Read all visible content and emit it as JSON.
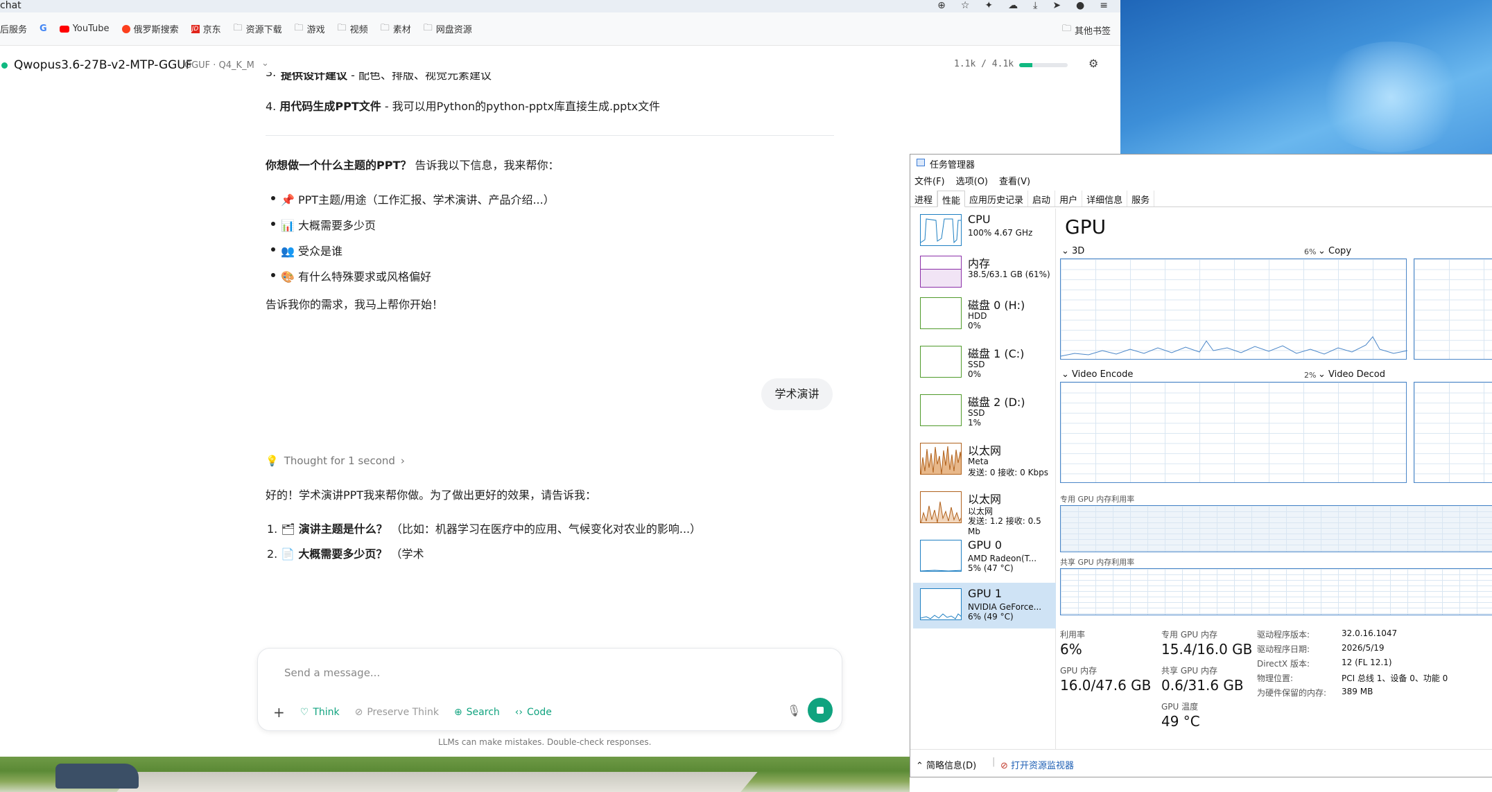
{
  "browser": {
    "tab_title": "chat",
    "bookmarks": [
      "后服务",
      "G",
      "YouTube",
      "俄罗斯搜索",
      "京东",
      "资源下载",
      "游戏",
      "视频",
      "素材",
      "网盘资源"
    ],
    "other_bookmarks": "其他书签"
  },
  "chat": {
    "model": "Qwopus3.6-27B-v2-MTP-GGUF",
    "format": "GGUF · Q4_K_M",
    "context": "1.1k / 4.1k",
    "context_fraction": 0.27,
    "cut_line": {
      "bold": "提供设计建议",
      "rest": " - 配色、排版、视觉元素建议"
    },
    "item4": {
      "num": "4.",
      "bold": "用代码生成PPT文件",
      "rest": " - 我可以用Python的python-pptx库直接生成.pptx文件"
    },
    "question": {
      "bold": "你想做一个什么主题的PPT？",
      "rest": " 告诉我以下信息，我来帮你："
    },
    "bullets": [
      "📌 PPT主题/用途（工作汇报、学术演讲、产品介绍...）",
      "📊 大概需要多少页",
      "👥 受众是谁",
      "🎨 有什么特殊要求或风格偏好"
    ],
    "closing": "告诉我你的需求，我马上帮你开始！",
    "user_message": "学术演讲",
    "thought": "Thought for 1 second",
    "reply_intro": "好的！学术演讲PPT我来帮你做。为了做出更好的效果，请告诉我：",
    "reply_items": [
      {
        "num": "1.",
        "emoji": "🗂",
        "bold": "演讲主题是什么？",
        "rest": " （比如：机器学习在医疗中的应用、气候变化对农业的影响...）"
      },
      {
        "num": "2.",
        "emoji": "📄",
        "bold": "大概需要多少页？",
        "rest": " （学术"
      }
    ],
    "input_placeholder": "Send a message...",
    "tools": {
      "think": "Think",
      "preserve_think": "Preserve Think",
      "search": "Search",
      "code": "Code"
    },
    "disclaimer": "LLMs can make mistakes. Double-check responses."
  },
  "taskmgr": {
    "title": "任务管理器",
    "menu": [
      "文件(F)",
      "选项(O)",
      "查看(V)"
    ],
    "tabs": [
      "进程",
      "性能",
      "应用历史记录",
      "启动",
      "用户",
      "详细信息",
      "服务"
    ],
    "active_tab": "性能",
    "resources": [
      {
        "name": "CPU",
        "l1": "100% 4.67 GHz",
        "l2": "",
        "color": "#1e7fc2"
      },
      {
        "name": "内存",
        "l1": "38.5/63.1 GB (61%)",
        "l2": "",
        "color": "#8b2fa8"
      },
      {
        "name": "磁盘 0 (H:)",
        "l1": "HDD",
        "l2": "0%",
        "color": "#4f9a2a"
      },
      {
        "name": "磁盘 1 (C:)",
        "l1": "SSD",
        "l2": "0%",
        "color": "#4f9a2a"
      },
      {
        "name": "磁盘 2 (D:)",
        "l1": "SSD",
        "l2": "1%",
        "color": "#4f9a2a"
      },
      {
        "name": "以太网",
        "l1": "Meta",
        "l2": "发送: 0 接收: 0 Kbps",
        "color": "#b0611c"
      },
      {
        "name": "以太网",
        "l1": "以太网",
        "l2": "发送: 1.2 接收: 0.5 Mb",
        "color": "#b0611c"
      },
      {
        "name": "GPU 0",
        "l1": "AMD Radeon(T...",
        "l2": "5% (47 °C)",
        "color": "#1e7fc2"
      },
      {
        "name": "GPU 1",
        "l1": "NVIDIA GeForce...",
        "l2": "6% (49 °C)",
        "color": "#1e7fc2"
      }
    ],
    "gpu_title": "GPU",
    "engines": {
      "e3d": "3D",
      "e3d_pct": "6%",
      "copy": "Copy",
      "venc": "Video Encode",
      "venc_pct": "2%",
      "vdec": "Video Decod"
    },
    "dedicated_label": "专用 GPU 内存利用率",
    "shared_label": "共享 GPU 内存利用率",
    "stats": {
      "util_label": "利用率",
      "util": "6%",
      "ded_label": "专用 GPU 内存",
      "ded": "15.4/16.0 GB",
      "gpumem_label": "GPU 内存",
      "gpumem": "16.0/47.6 GB",
      "shared_label": "共享 GPU 内存",
      "shared": "0.6/31.6 GB",
      "temp_label": "GPU 温度",
      "temp": "49 °C"
    },
    "info": [
      {
        "k": "驱动程序版本:",
        "v": "32.0.16.1047"
      },
      {
        "k": "驱动程序日期:",
        "v": "2026/5/19"
      },
      {
        "k": "DirectX 版本:",
        "v": "12 (FL 12.1)"
      },
      {
        "k": "物理位置:",
        "v": "PCI 总线 1、设备 0、功能 0"
      },
      {
        "k": "为硬件保留的内存:",
        "v": "389 MB"
      }
    ],
    "footer": {
      "summary": "简略信息(D)",
      "monitor": "打开资源监视器"
    }
  }
}
